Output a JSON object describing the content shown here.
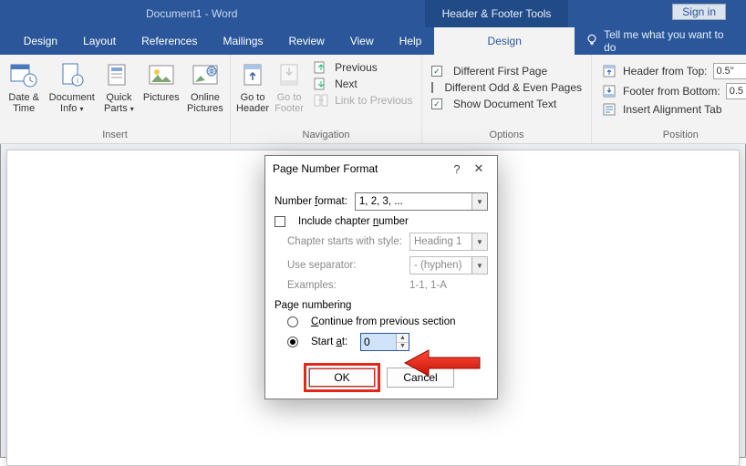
{
  "titlebar": {
    "doc": "Document1  -  Word",
    "context": "Header & Footer Tools",
    "signin": "Sign in"
  },
  "tabs": {
    "design": "Design",
    "layout": "Layout",
    "references": "References",
    "mailings": "Mailings",
    "review": "Review",
    "view": "View",
    "help": "Help",
    "hf_design": "Design",
    "tellme": "Tell me what you want to do"
  },
  "ribbon": {
    "insert": {
      "caption": "Insert",
      "datetime": "Date & Time",
      "docinfo": "Document Info",
      "quickparts": "Quick Parts",
      "pictures": "Pictures",
      "onlinepics": "Online Pictures"
    },
    "navigation": {
      "caption": "Navigation",
      "gotoheader": "Go to Header",
      "gotofooter": "Go to Footer",
      "previous": "Previous",
      "next": "Next",
      "linkprevious": "Link to Previous"
    },
    "options": {
      "caption": "Options",
      "difffirst": "Different First Page",
      "diffodd": "Different Odd & Even Pages",
      "showdoc": "Show Document Text"
    },
    "position": {
      "caption": "Position",
      "headerfromtop": "Header from Top:",
      "footerfrombottom": "Footer from Bottom:",
      "insertaligntab": "Insert Alignment Tab",
      "header_val": "0.5\"",
      "footer_val": "0.5"
    }
  },
  "dialog": {
    "title": "Page Number Format",
    "numfmt_label": "Number format:",
    "numfmt_value": "1, 2, 3, ...",
    "include_chapter": "Include chapter number",
    "chapter_style_label": "Chapter starts with style:",
    "chapter_style_value": "Heading 1",
    "separator_label": "Use separator:",
    "separator_value": "-   (hyphen)",
    "examples_label": "Examples:",
    "examples_value": "1-1, 1-A",
    "pagenumbering": "Page numbering",
    "continue": "Continue from previous section",
    "startat": "Start at:",
    "startat_value": "0",
    "ok": "OK",
    "cancel": "Cancel"
  }
}
